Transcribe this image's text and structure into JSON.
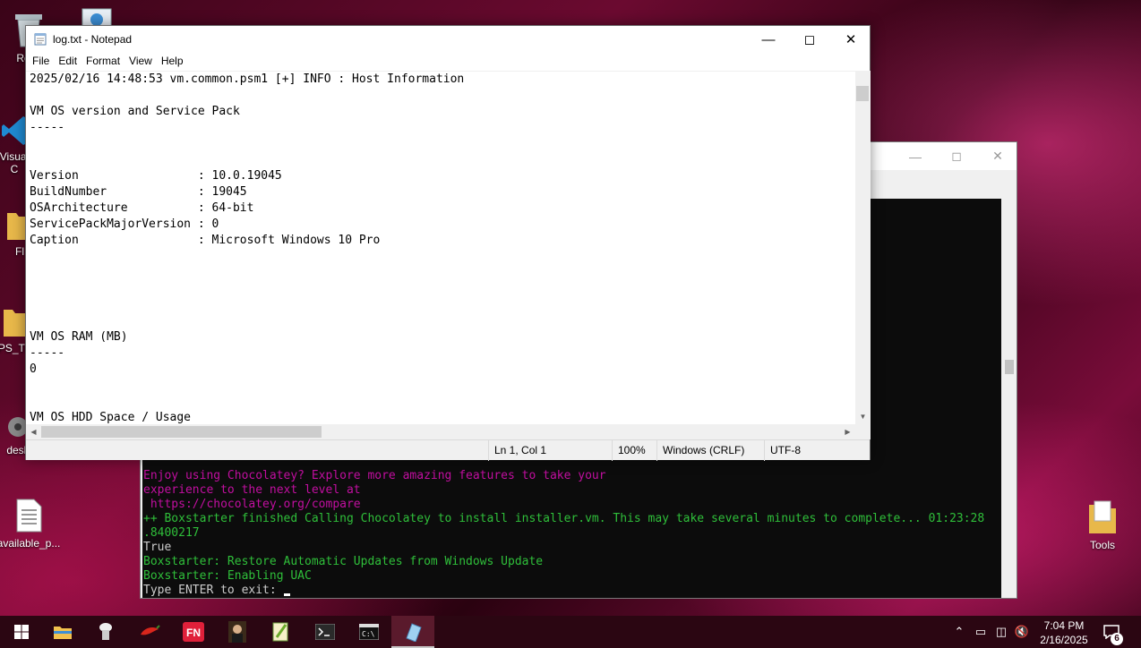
{
  "desktop": {
    "icons": [
      {
        "label": "Recy"
      },
      {
        "label": "Visual\nC"
      },
      {
        "label": "Fl"
      },
      {
        "label": "PS_Tra"
      },
      {
        "label": "desk"
      },
      {
        "label": "available_p..."
      },
      {
        "label": "Tools"
      }
    ]
  },
  "notepad": {
    "title": "log.txt - Notepad",
    "menu": [
      "File",
      "Edit",
      "Format",
      "View",
      "Help"
    ],
    "content": "2025/02/16 14:48:53 vm.common.psm1 [+] INFO : Host Information\n\nVM OS version and Service Pack\n-----\n\n\nVersion                 : 10.0.19045\nBuildNumber             : 19045\nOSArchitecture          : 64-bit\nServicePackMajorVersion : 0\nCaption                 : Microsoft Windows 10 Pro\n\n\n\n\n\nVM OS RAM (MB)\n-----\n0\n\n\nVM OS HDD Space / Usage",
    "status": {
      "position": "Ln 1, Col 1",
      "zoom": "100%",
      "line_ending": "Windows (CRLF)",
      "encoding": "UTF-8"
    }
  },
  "terminal": {
    "lines": [
      {
        "text": "Enjoy using Chocolatey? Explore more amazing features to take your",
        "color": "magenta"
      },
      {
        "text": "experience to the next level at",
        "color": "magenta"
      },
      {
        "text": " https://chocolatey.org/compare",
        "color": "magenta"
      },
      {
        "text": "++ Boxstarter finished Calling Chocolatey to install installer.vm. This may take several minutes to complete... 01:23:28",
        "color": "green"
      },
      {
        "text": ".8400217",
        "color": "green"
      },
      {
        "text": "True",
        "color": "white"
      },
      {
        "text": "Boxstarter: Restore Automatic Updates from Windows Update",
        "color": "green"
      },
      {
        "text": "Boxstarter: Enabling UAC",
        "color": "green"
      },
      {
        "text": "Type ENTER to exit: ",
        "color": "white"
      }
    ]
  },
  "taskbar": {
    "apps": [
      "start",
      "file-explorer",
      "chef",
      "chili",
      "fn",
      "portrait",
      "notepadpp",
      "terminal",
      "cmd",
      "notepad"
    ],
    "clock": {
      "time": "7:04 PM",
      "date": "2/16/2025"
    },
    "notifications": "6"
  },
  "colors": {
    "terminal_magenta": "#c20fa0",
    "terminal_green": "#2fbf3a",
    "taskbar": "#2b0612"
  }
}
